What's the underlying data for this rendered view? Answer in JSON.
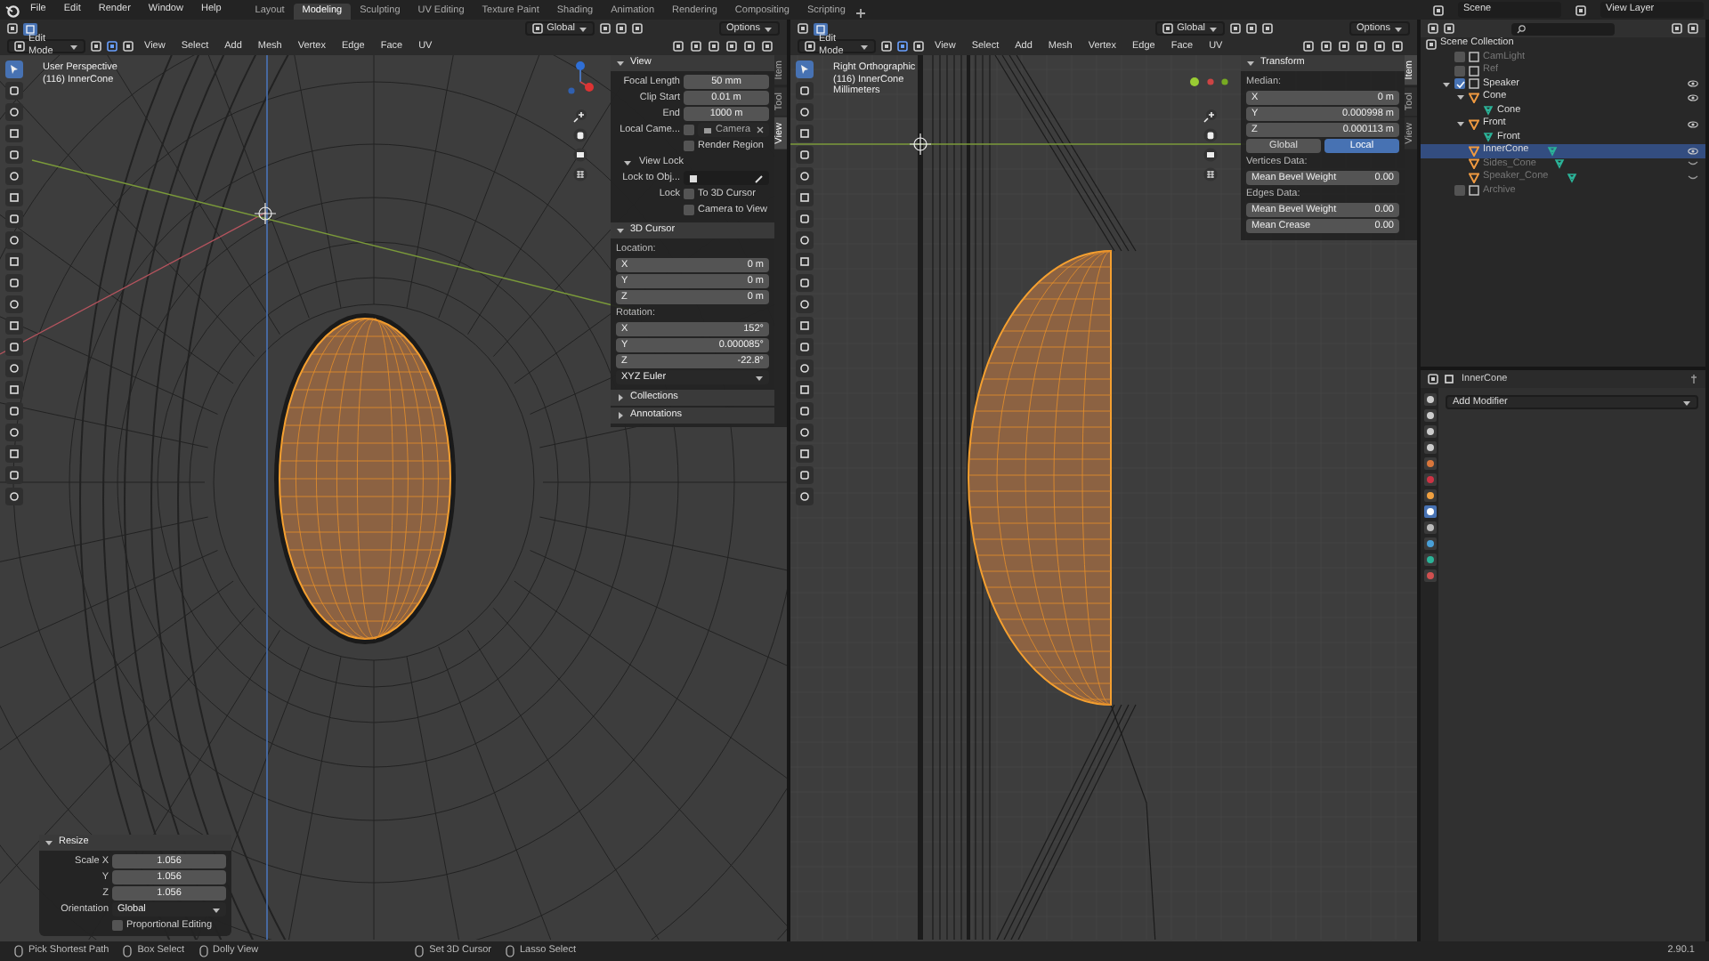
{
  "menu": [
    "File",
    "Edit",
    "Render",
    "Window",
    "Help"
  ],
  "workspaces": [
    {
      "label": "Layout",
      "selected": false
    },
    {
      "label": "Modeling",
      "selected": true
    },
    {
      "label": "Sculpting",
      "selected": false
    },
    {
      "label": "UV Editing",
      "selected": false
    },
    {
      "label": "Texture Paint",
      "selected": false
    },
    {
      "label": "Shading",
      "selected": false
    },
    {
      "label": "Animation",
      "selected": false
    },
    {
      "label": "Rendering",
      "selected": false
    },
    {
      "label": "Compositing",
      "selected": false
    },
    {
      "label": "Scripting",
      "selected": false
    }
  ],
  "scene": "Scene",
  "view_layer": "View Layer",
  "viewports": [
    {
      "kind": "perspective",
      "orientation": "Global",
      "options": "Options",
      "mode": "Edit Mode",
      "menus": [
        "View",
        "Select",
        "Add",
        "Mesh",
        "Vertex",
        "Edge",
        "Face",
        "UV"
      ],
      "overlay_lines": [
        "User Perspective",
        "(116) InnerCone"
      ],
      "tools": [
        {
          "selected": true
        },
        {
          "selected": false
        },
        {
          "selected": false
        },
        {
          "selected": false
        },
        {
          "selected": false
        },
        {
          "selected": false
        },
        {
          "selected": false
        },
        {
          "selected": false
        },
        {
          "selected": false
        },
        {
          "selected": false
        },
        {
          "selected": false
        },
        {
          "selected": false
        },
        {
          "selected": false
        },
        {
          "selected": false
        },
        {
          "selected": false
        },
        {
          "selected": false
        },
        {
          "selected": false
        },
        {
          "selected": false
        },
        {
          "selected": false
        },
        {
          "selected": false
        },
        {
          "selected": false
        }
      ],
      "sidebar": {
        "tabs": [
          {
            "label": "Item",
            "selected": false
          },
          {
            "label": "Tool",
            "selected": false
          },
          {
            "label": "View",
            "selected": true
          }
        ],
        "panels": [
          {
            "title": "View",
            "expanded": true,
            "rows": [
              {
                "kind": "field",
                "label": "Focal Length",
                "value": "50 mm"
              },
              {
                "kind": "field",
                "label": "Clip Start",
                "value": "0.01 m"
              },
              {
                "kind": "field",
                "label": "End",
                "value": "1000 m"
              },
              {
                "kind": "camera_field",
                "label": "Local Came...",
                "checked": false,
                "value": "Camera"
              },
              {
                "kind": "checkbox",
                "text": "Render Region",
                "checked": false
              },
              {
                "kind": "subpanel",
                "label": "View Lock",
                "expanded": true
              },
              {
                "kind": "object_field",
                "label": "Lock to Obj..."
              },
              {
                "kind": "checkbox",
                "label": "Lock",
                "text": "To 3D Cursor",
                "checked": false
              },
              {
                "kind": "checkbox",
                "text": "Camera to View",
                "checked": false
              }
            ]
          },
          {
            "title": "3D Cursor",
            "expanded": true,
            "rows": [
              {
                "kind": "heading",
                "label": "Location:"
              },
              {
                "kind": "vector",
                "label": "X",
                "value": "0 m"
              },
              {
                "kind": "vector",
                "label": "Y",
                "value": "0 m"
              },
              {
                "kind": "vector",
                "label": "Z",
                "value": "0 m"
              },
              {
                "kind": "heading",
                "label": "Rotation:"
              },
              {
                "kind": "vector",
                "label": "X",
                "value": "152°"
              },
              {
                "kind": "vector",
                "label": "Y",
                "value": "0.000085°"
              },
              {
                "kind": "vector",
                "label": "Z",
                "value": "-22.8°"
              },
              {
                "kind": "dropdown",
                "value": "XYZ Euler"
              }
            ]
          },
          {
            "title": "Collections",
            "expanded": false
          },
          {
            "title": "Annotations",
            "expanded": false
          }
        ]
      },
      "operator": {
        "title": "Resize",
        "expanded": true,
        "rows": [
          {
            "kind": "field",
            "label": "Scale X",
            "value": "1.056"
          },
          {
            "kind": "field",
            "label": "Y",
            "value": "1.056"
          },
          {
            "kind": "field",
            "label": "Z",
            "value": "1.056"
          },
          {
            "kind": "dropdown_field",
            "label": "Orientation",
            "value": "Global"
          },
          {
            "kind": "checkbox",
            "text": "Proportional Editing",
            "checked": false
          }
        ]
      }
    },
    {
      "kind": "orthographic",
      "orientation": "Global",
      "options": "Options",
      "mode": "Edit Mode",
      "menus": [
        "View",
        "Select",
        "Add",
        "Mesh",
        "Vertex",
        "Edge",
        "Face",
        "UV"
      ],
      "overlay_lines": [
        "Right Orthographic",
        "(116) InnerCone",
        "Millimeters"
      ],
      "tools": [
        {
          "selected": true
        },
        {
          "selected": false
        },
        {
          "selected": false
        },
        {
          "selected": false
        },
        {
          "selected": false
        },
        {
          "selected": false
        },
        {
          "selected": false
        },
        {
          "selected": false
        },
        {
          "selected": false
        },
        {
          "selected": false
        },
        {
          "selected": false
        },
        {
          "selected": false
        },
        {
          "selected": false
        },
        {
          "selected": false
        },
        {
          "selected": false
        },
        {
          "selected": false
        },
        {
          "selected": false
        },
        {
          "selected": false
        },
        {
          "selected": false
        },
        {
          "selected": false
        },
        {
          "selected": false
        }
      ],
      "sidebar": {
        "tabs": [
          {
            "label": "Item",
            "selected": true
          },
          {
            "label": "Tool",
            "selected": false
          },
          {
            "label": "View",
            "selected": false
          }
        ],
        "panels": [
          {
            "title": "Transform",
            "expanded": true,
            "rows": [
              {
                "kind": "heading",
                "label": "Median:"
              },
              {
                "kind": "vector",
                "label": "X",
                "value": "0 m"
              },
              {
                "kind": "vector",
                "label": "Y",
                "value": "0.000998 m"
              },
              {
                "kind": "vector",
                "label": "Z",
                "value": "0.000113 m"
              },
              {
                "kind": "toggle",
                "options": [
                  {
                    "label": "Global",
                    "selected": false
                  },
                  {
                    "label": "Local",
                    "selected": true
                  }
                ]
              },
              {
                "kind": "heading",
                "label": "Vertices Data:"
              },
              {
                "kind": "vector",
                "label": "Mean Bevel Weight",
                "value": "0.00"
              },
              {
                "kind": "heading",
                "label": "Edges Data:"
              },
              {
                "kind": "vector",
                "label": "Mean Bevel Weight",
                "value": "0.00"
              },
              {
                "kind": "vector",
                "label": "Mean Crease",
                "value": "0.00"
              }
            ]
          }
        ]
      }
    }
  ],
  "outliner": {
    "root": "Scene Collection",
    "items": [
      {
        "label": "CamLight",
        "kind": "collection",
        "checked": false
      },
      {
        "label": "Ref",
        "kind": "collection",
        "checked": false
      },
      {
        "label": "Speaker",
        "kind": "collection",
        "checked": true,
        "expanded": true,
        "children": [
          {
            "label": "Cone",
            "kind": "object",
            "selected": false,
            "hidden": false,
            "expanded": true,
            "children": [
              {
                "label": "Cone",
                "kind": "mesh"
              }
            ]
          },
          {
            "label": "Front",
            "kind": "object",
            "selected": false,
            "hidden": false,
            "expanded": true,
            "children": [
              {
                "label": "Front",
                "kind": "mesh"
              }
            ]
          },
          {
            "label": "InnerCone",
            "kind": "object",
            "selected": true,
            "hidden": false,
            "expanded": false
          },
          {
            "label": "Sides_Cone",
            "kind": "object",
            "selected": false,
            "hidden": true,
            "expanded": false
          },
          {
            "label": "Speaker_Cone",
            "kind": "object",
            "selected": false,
            "hidden": true,
            "expanded": false
          }
        ]
      },
      {
        "label": "Archive",
        "kind": "collection",
        "checked": false
      }
    ]
  },
  "properties": {
    "object": "InnerCone",
    "add_modifier": "Add Modifier",
    "tabs": [
      {
        "selected": false
      },
      {
        "selected": false
      },
      {
        "selected": false
      },
      {
        "selected": false
      },
      {
        "selected": false
      },
      {
        "selected": false
      },
      {
        "selected": false
      },
      {
        "selected": true
      },
      {
        "selected": false
      },
      {
        "selected": false
      },
      {
        "selected": false
      },
      {
        "selected": false
      }
    ]
  },
  "status_bar": {
    "items": [
      "Pick Shortest Path",
      "Box Select",
      "Dolly View",
      "Set 3D Cursor",
      "Lasso Select"
    ],
    "version": "2.90.1"
  }
}
